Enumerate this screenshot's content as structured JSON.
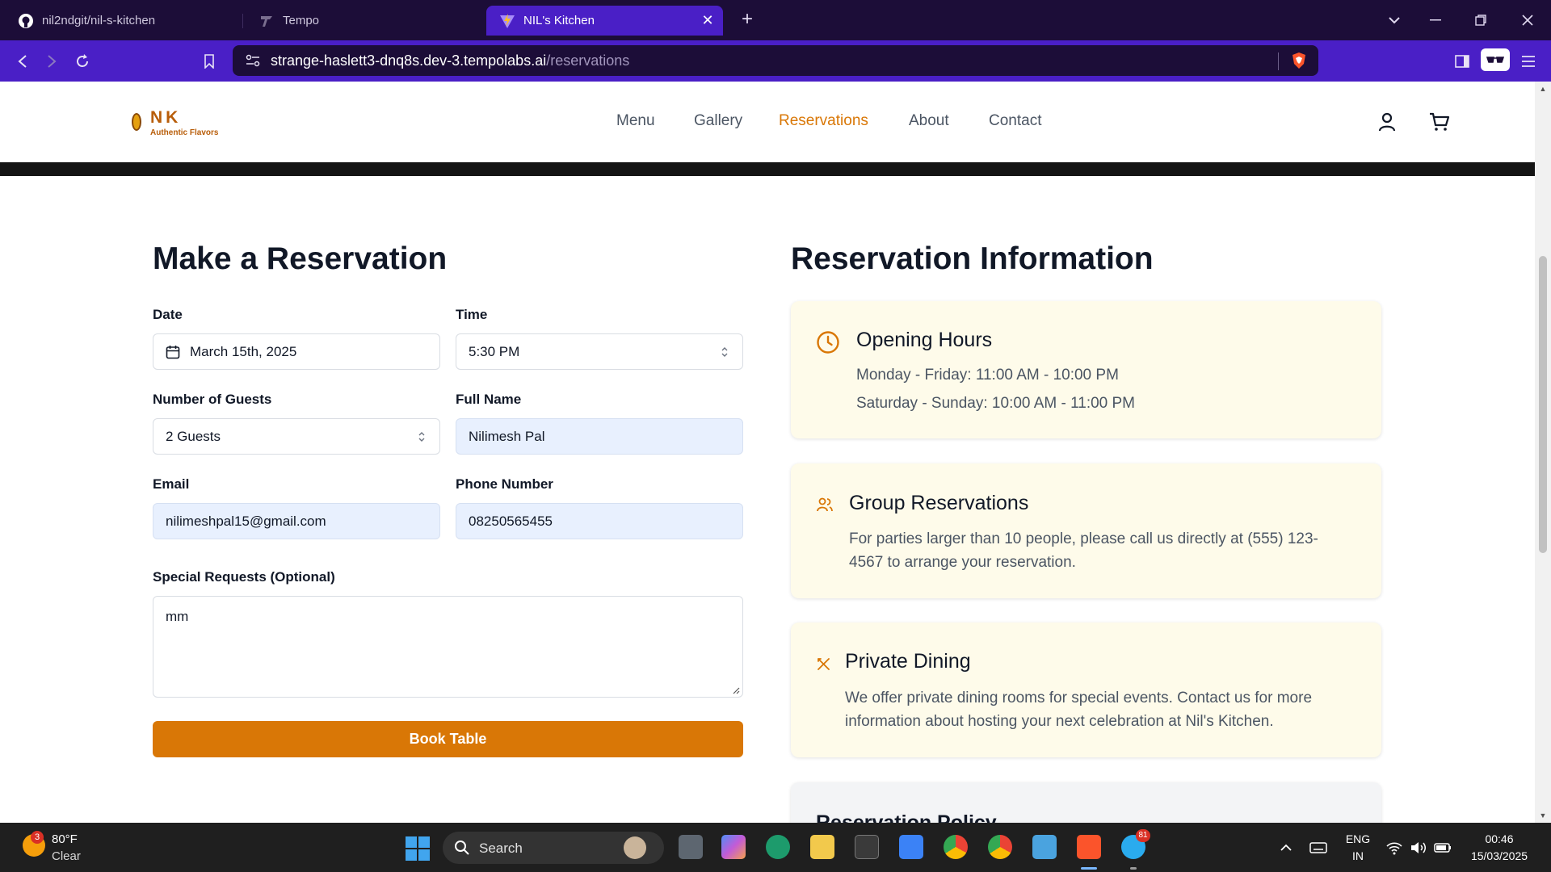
{
  "browser": {
    "tabs": [
      {
        "label": "nil2ndgit/nil-s-kitchen",
        "icon": "github-icon"
      },
      {
        "label": "Tempo",
        "icon": "tempo-icon"
      },
      {
        "label": "NIL's Kitchen",
        "icon": "vite-icon",
        "active": true
      }
    ],
    "url_host": "strange-haslett3-dnq8s.dev-3.tempolabs.ai",
    "url_path": "/reservations"
  },
  "site": {
    "logo_text": "NK",
    "logo_tagline": "Authentic Flavors",
    "nav": [
      "Menu",
      "Gallery",
      "Reservations",
      "About",
      "Contact"
    ],
    "active_nav": "Reservations",
    "accent_color": "#d97706"
  },
  "form": {
    "title": "Make a Reservation",
    "date_label": "Date",
    "date_value": "March 15th, 2025",
    "time_label": "Time",
    "time_value": "5:30 PM",
    "guests_label": "Number of Guests",
    "guests_value": "2 Guests",
    "name_label": "Full Name",
    "name_value": "Nilimesh Pal",
    "email_label": "Email",
    "email_value": "nilimeshpal15@gmail.com",
    "phone_label": "Phone Number",
    "phone_value": "08250565455",
    "requests_label": "Special Requests (Optional)",
    "requests_value": "mm",
    "submit_label": "Book Table"
  },
  "info": {
    "title": "Reservation Information",
    "cards": [
      {
        "icon": "clock-icon",
        "title": "Opening Hours",
        "lines": [
          "Monday - Friday: 11:00 AM - 10:00 PM",
          "Saturday - Sunday: 10:00 AM - 11:00 PM"
        ]
      },
      {
        "icon": "users-icon",
        "title": "Group Reservations",
        "lines": [
          "For parties larger than 10 people, please call us directly at (555) 123-",
          "4567 to arrange your reservation."
        ]
      },
      {
        "icon": "utensils-icon",
        "title": "Private Dining",
        "lines": [
          "We offer private dining rooms for special events. Contact us for more",
          "information about hosting your next celebration at Nil's Kitchen."
        ]
      },
      {
        "title": "Reservation Policy"
      }
    ]
  },
  "taskbar": {
    "weather_temp": "80°F",
    "weather_cond": "Clear",
    "weather_badge": "3",
    "search_placeholder": "Search",
    "telegram_badge": "81",
    "lang_top": "ENG",
    "lang_bottom": "IN",
    "time": "00:46",
    "date": "15/03/2025"
  }
}
